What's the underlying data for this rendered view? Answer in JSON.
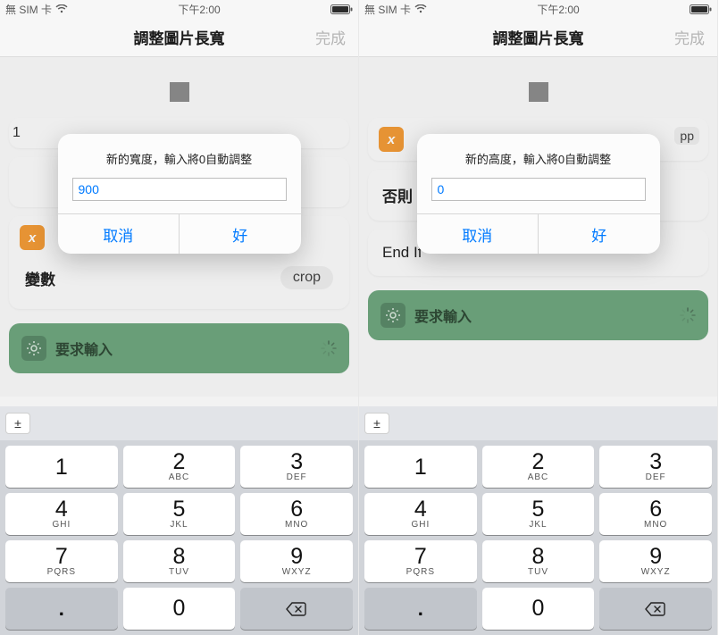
{
  "status": {
    "carrier": "無 SIM 卡",
    "time": "下午2:00"
  },
  "nav": {
    "title": "調整圖片長寬",
    "done": "完成"
  },
  "screens": [
    {
      "alert_title": "新的寬度，輸入將0自動調整",
      "alert_value": "900",
      "bg_rows": [
        "1",
        "",
        "變數"
      ],
      "crop_label": "crop",
      "show_one": true,
      "show_else": false
    },
    {
      "alert_title": "新的高度，輸入將0自動調整",
      "alert_value": "0",
      "bg_rows": [
        "否則",
        "End If"
      ],
      "crop_label": "",
      "show_one": false,
      "show_else": true
    }
  ],
  "alert": {
    "cancel": "取消",
    "ok": "好"
  },
  "green": {
    "label": "要求輸入"
  },
  "var": {
    "label": "變數",
    "crop": "crop",
    "else": "否則",
    "endif": "End If",
    "icon": "x"
  },
  "keyboard": {
    "pm": "±",
    "keys": [
      {
        "d": "1",
        "s": ""
      },
      {
        "d": "2",
        "s": "ABC"
      },
      {
        "d": "3",
        "s": "DEF"
      },
      {
        "d": "4",
        "s": "GHI"
      },
      {
        "d": "5",
        "s": "JKL"
      },
      {
        "d": "6",
        "s": "MNO"
      },
      {
        "d": "7",
        "s": "PQRS"
      },
      {
        "d": "8",
        "s": "TUV"
      },
      {
        "d": "9",
        "s": "WXYZ"
      }
    ],
    "dot": ".",
    "zero": "0"
  }
}
